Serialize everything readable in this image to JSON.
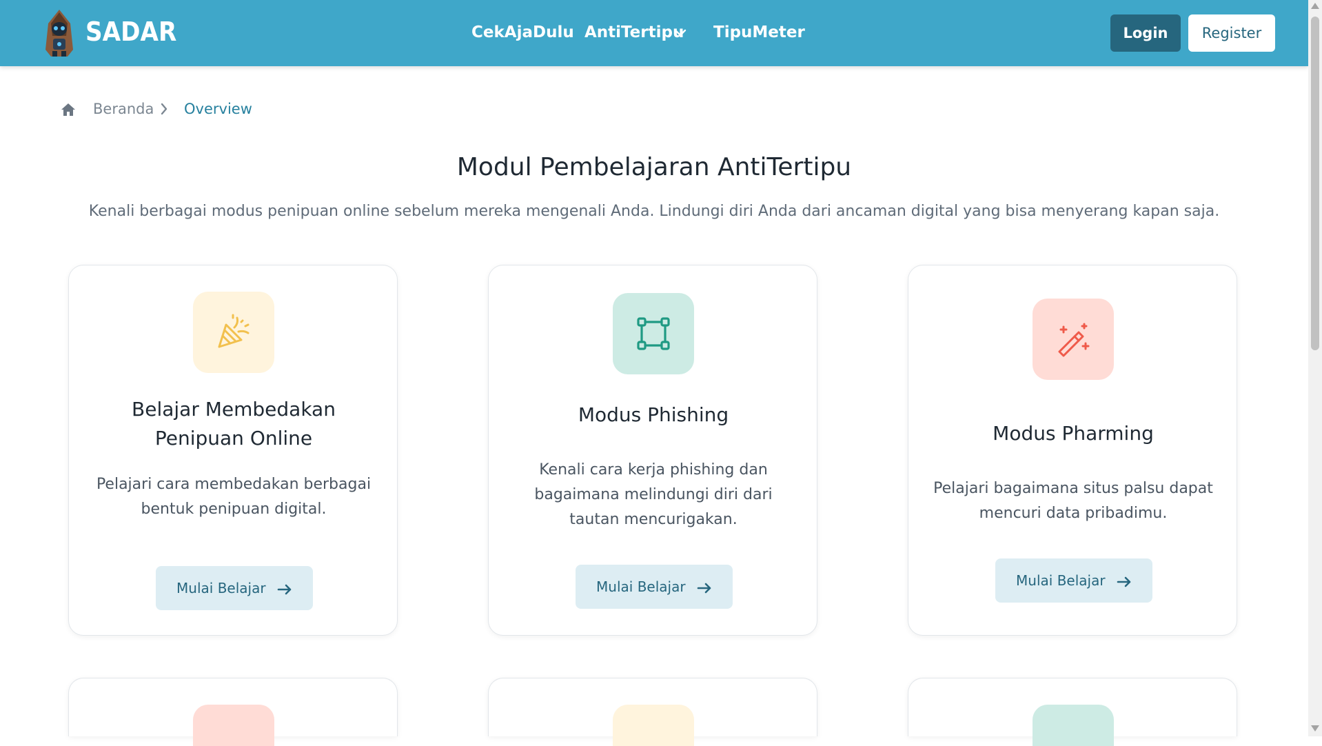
{
  "app": {
    "brand": "SADAR",
    "accent_color": "#3fa7c9",
    "dark_accent": "#26667e"
  },
  "nav": {
    "items": [
      "CekAjaDulu",
      "AntiTertipu",
      "TipuMeter"
    ],
    "dropdown_icon": "chevron-down-icon",
    "login": "Login",
    "register": "Register"
  },
  "breadcrumb": {
    "home_icon": "home-icon",
    "items": [
      "Beranda",
      "Overview"
    ]
  },
  "hero": {
    "title": "Modul Pembelajaran AntiTertipu",
    "subtitle": "Kenali berbagai modus penipuan online sebelum mereka mengenali Anda. Lindungi diri Anda dari ancaman digital yang bisa menyerang kapan saja."
  },
  "cards": [
    {
      "icon": "party-popper-icon",
      "icon_bg": "#fff4dd",
      "title": "Belajar Membedakan Penipuan Online",
      "description": "Pelajari cara membedakan berbagai bentuk penipuan digital.",
      "button": "Mulai Belajar"
    },
    {
      "icon": "bounding-box-icon",
      "icon_bg": "#cdebe4",
      "title": "Modus Phishing",
      "description": "Kenali cara kerja phishing dan bagaimana melindungi diri dari tautan mencurigakan.",
      "button": "Mulai Belajar"
    },
    {
      "icon": "magic-wand-icon",
      "icon_bg": "#ffdcd6",
      "title": "Modus Pharming",
      "description": "Pelajari bagaimana situs palsu dapat mencuri data pribadimu.",
      "button": "Mulai Belajar"
    }
  ],
  "partial_cards": [
    {
      "icon_bg": "#ffdcd6"
    },
    {
      "icon_bg": "#fff4dd"
    },
    {
      "icon_bg": "#cdebe4"
    }
  ]
}
